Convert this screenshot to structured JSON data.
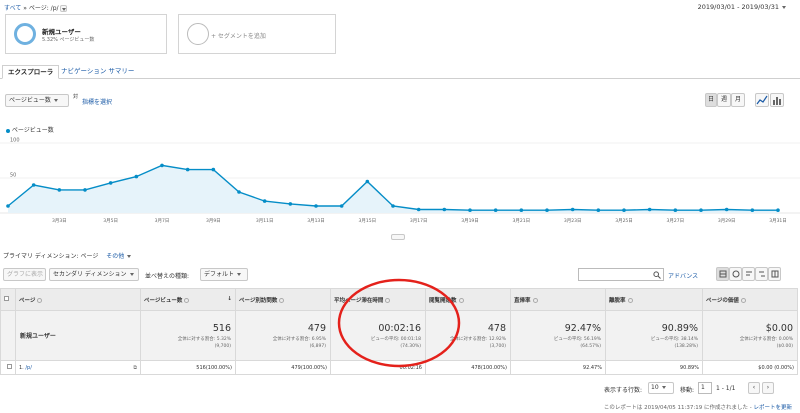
{
  "breadcrumb": {
    "all": "すべて",
    "separator": "»",
    "page": "ページ: /p/"
  },
  "date_range": "2019/03/01 - 2019/03/31",
  "segments": [
    {
      "name": "新規ユーザー",
      "sub": "5.32% ページビュー数"
    },
    {
      "name": "+ セグメントを追加"
    }
  ],
  "tabs": {
    "explorer": "エクスプローラ",
    "nav_summary": "ナビゲーション サマリー"
  },
  "metric_select": "ページビュー数",
  "vs": "対",
  "select_metric": "指標を選択",
  "period_buttons": [
    "日",
    "週",
    "月"
  ],
  "legend_label": "ページビュー数",
  "chart_data": {
    "type": "area",
    "series": [
      {
        "name": "ページビュー数",
        "values": [
          10,
          40,
          33,
          33,
          43,
          52,
          68,
          62,
          62,
          30,
          17,
          13,
          10,
          10,
          45,
          10,
          5,
          5,
          4,
          4,
          4,
          4,
          5,
          4,
          4,
          5,
          4,
          4,
          5,
          4,
          4
        ]
      }
    ],
    "x_labels": [
      "3月3日",
      "3月5日",
      "3月7日",
      "3月9日",
      "3月11日",
      "3月13日",
      "3月15日",
      "3月17日",
      "3月19日",
      "3月21日",
      "3月23日",
      "3月25日",
      "3月27日",
      "3月29日",
      "3月31日"
    ],
    "y_ticks": [
      100,
      50
    ],
    "ylim": [
      0,
      100
    ],
    "color": "#058dc7",
    "fill": "#e6f3fa"
  },
  "primary_dimension": {
    "label": "プライマリ ディメンション:",
    "value": "ページ",
    "other": "その他"
  },
  "toolbar": {
    "plot_rows": "グラフに表示",
    "secondary_dim": "セカンダリ ディメンション",
    "sort_label": "並べ替えの種類:",
    "sort_value": "デフォルト",
    "advanced": "アドバンス"
  },
  "table": {
    "headers": [
      "ページ",
      "ページビュー数",
      "ページ別訪問数",
      "平均ページ滞在時間",
      "閲覧開始数",
      "直帰率",
      "離脱率",
      "ページの価値"
    ],
    "total_label": "新規ユーザー",
    "totals": [
      {
        "value": "516",
        "sub1": "全体に対する割合: 5.32%",
        "sub2": "(9,700)"
      },
      {
        "value": "479",
        "sub1": "全体に対する割合: 6.95%",
        "sub2": "(6,897)"
      },
      {
        "value": "00:02:16",
        "sub1": "ビューの平均: 00:01:18",
        "sub2": "(74.30%)"
      },
      {
        "value": "478",
        "sub1": "全体に対する割合: 12.92%",
        "sub2": "(3,700)"
      },
      {
        "value": "92.47%",
        "sub1": "ビューの平均: 56.19%",
        "sub2": "(64.57%)"
      },
      {
        "value": "90.89%",
        "sub1": "ビューの平均: 38.14%",
        "sub2": "(138.28%)"
      },
      {
        "value": "$0.00",
        "sub1": "全体に対する割合: 0.00%",
        "sub2": "($0.00)"
      }
    ],
    "row": {
      "index": "1.",
      "page": "/p/",
      "values": [
        "516(100.00%)",
        "479(100.00%)",
        "00:02:16",
        "478(100.00%)",
        "92.47%",
        "90.89%",
        "$0.00 (0.00%)"
      ]
    }
  },
  "pagination": {
    "rows_label": "表示する行数:",
    "rows_value": "10",
    "goto_label": "移動:",
    "goto_value": "1",
    "range": "1 - 1/1"
  },
  "footer": {
    "text": "このレポートは 2019/04/05 11:37:19 に作成されました -",
    "link": "レポートを更新"
  }
}
